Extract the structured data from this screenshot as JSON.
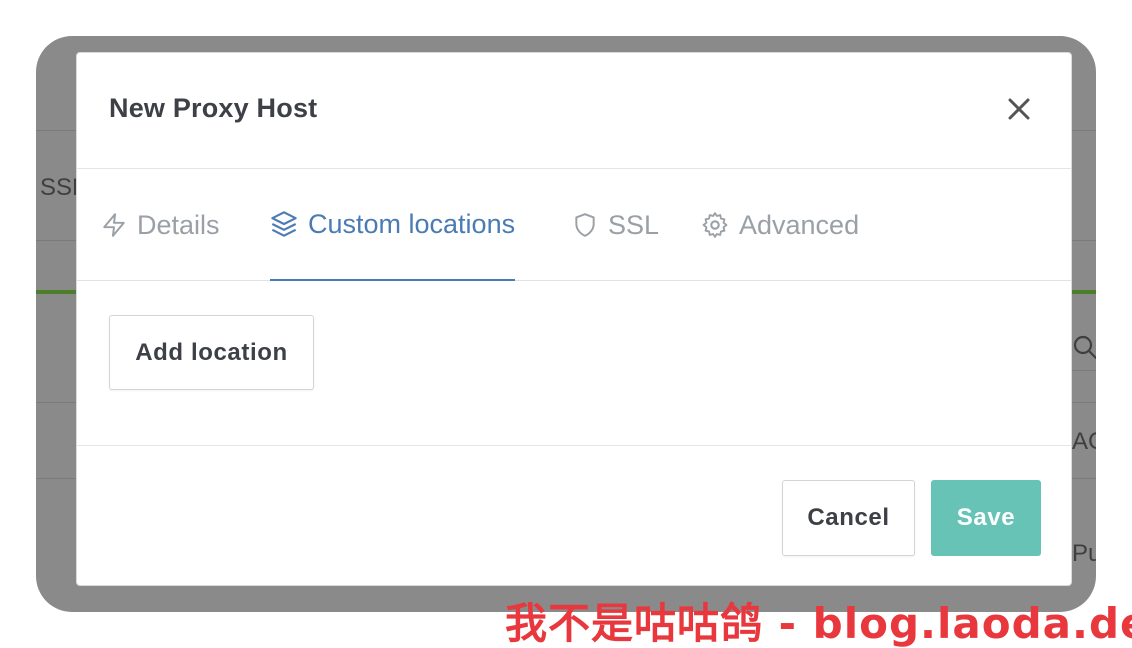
{
  "background": {
    "col_ssl": "SSL",
    "col_search_hint": "Q",
    "col_ac": "AC",
    "col_pu": "Pu"
  },
  "modal": {
    "title": "New Proxy Host",
    "tabs": [
      {
        "label": "Details",
        "icon": "lightning-icon",
        "active": false
      },
      {
        "label": "Custom locations",
        "icon": "layers-icon",
        "active": true
      },
      {
        "label": "SSL",
        "icon": "shield-icon",
        "active": false
      },
      {
        "label": "Advanced",
        "icon": "gear-icon",
        "active": false
      }
    ],
    "add_location_label": "Add location",
    "cancel_label": "Cancel",
    "save_label": "Save"
  },
  "watermark": "我不是咕咕鸽 - blog.laoda.de",
  "colors": {
    "accent": "#4a7bb5",
    "save": "#66c3b5",
    "overlay": "#8a8a8a",
    "watermark": "#e8383d"
  }
}
